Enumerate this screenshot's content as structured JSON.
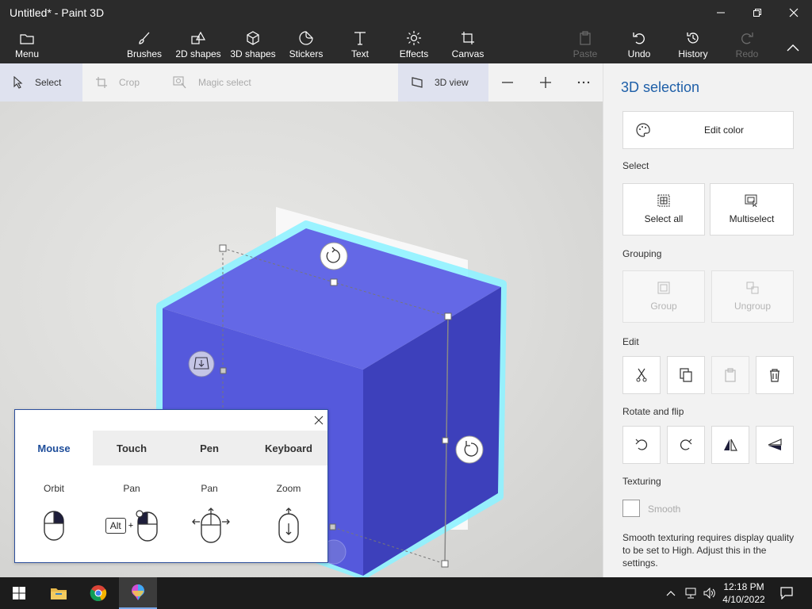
{
  "window": {
    "title": "Untitled* - Paint 3D"
  },
  "ribbon": {
    "menu": "Menu",
    "brushes": "Brushes",
    "shapes2d": "2D shapes",
    "shapes3d": "3D shapes",
    "stickers": "Stickers",
    "text": "Text",
    "effects": "Effects",
    "canvas": "Canvas",
    "paste": "Paste",
    "undo": "Undo",
    "history": "History",
    "redo": "Redo"
  },
  "tools": {
    "select": "Select",
    "crop": "Crop",
    "magic_select": "Magic select",
    "view3d": "3D view"
  },
  "help": {
    "tabs": [
      "Mouse",
      "Touch",
      "Pen",
      "Keyboard"
    ],
    "labels": [
      "Orbit",
      "Pan",
      "Pan",
      "Zoom"
    ],
    "alt_key": "Alt",
    "plus": "+"
  },
  "panel": {
    "title": "3D selection",
    "edit_color": "Edit color",
    "select_heading": "Select",
    "select_all": "Select all",
    "multiselect": "Multiselect",
    "grouping_heading": "Grouping",
    "group": "Group",
    "ungroup": "Ungroup",
    "edit_heading": "Edit",
    "rotate_heading": "Rotate and flip",
    "texturing_heading": "Texturing",
    "smooth": "Smooth",
    "smooth_note": "Smooth texturing requires display quality to be set to High. Adjust this in the settings."
  },
  "taskbar": {
    "time": "12:18 PM",
    "date": "4/10/2022"
  },
  "colors": {
    "cube_top": "#6468e6",
    "cube_left": "#5559dc",
    "cube_right": "#3d40bb",
    "selection_glow": "#8ff2ff",
    "accent": "#1e5fa8"
  }
}
